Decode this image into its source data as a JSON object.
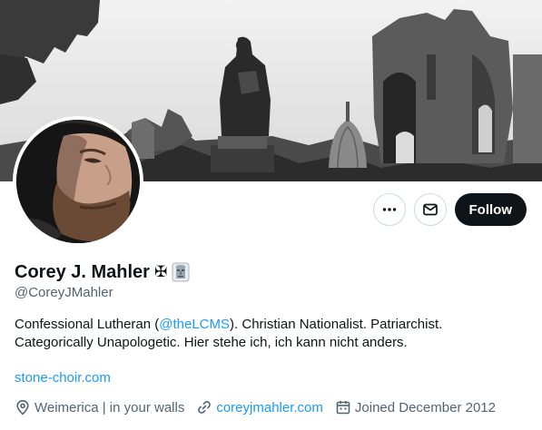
{
  "profile": {
    "display_name": "Corey J. Mahler",
    "name_glyph": "✠",
    "handle": "@CoreyJMahler",
    "bio_part1": "Confessional Lutheran (",
    "bio_mention": "@theLCMS",
    "bio_part2": "). Christian Nationalist. Patriarchist.",
    "bio_line2": "Categorically Unapologetic. Hier stehe ich, ich kann nicht anders.",
    "bio_website": "stone-choir.com",
    "location": "Weimerica | in your walls",
    "link": "coreyjmahler.com",
    "joined": "Joined December 2012"
  },
  "actions": {
    "more_icon": "more-horizontal-icon",
    "message_icon": "envelope-icon",
    "follow_label": "Follow"
  },
  "icons": {
    "location": "map-pin-icon",
    "link": "link-icon",
    "calendar": "calendar-icon",
    "badge": "moai-statue-icon"
  },
  "colors": {
    "accent": "#1d9bf0",
    "text": "#0f1419",
    "secondary": "#536471",
    "border": "#cfd9de",
    "follow_bg": "#0f1419"
  }
}
